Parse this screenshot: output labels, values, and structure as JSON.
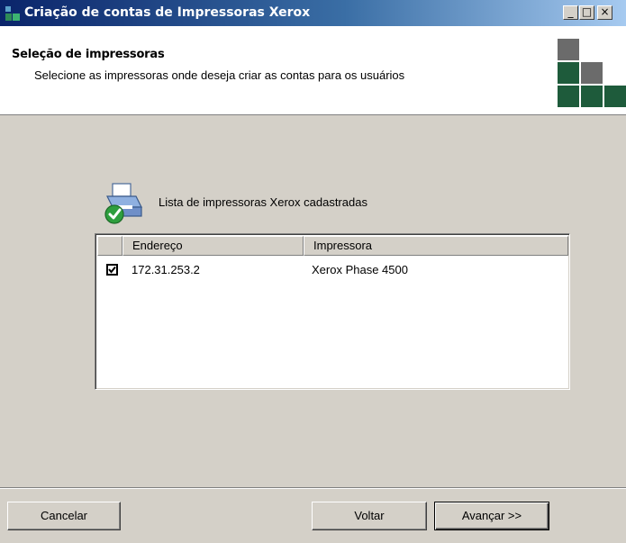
{
  "window": {
    "title": "Criação de contas de Impressoras Xerox",
    "minimize_glyph": "_",
    "maximize_glyph": "□",
    "close_glyph": "×"
  },
  "header": {
    "title": "Seleção de impressoras",
    "subtitle": "Selecione as impressoras onde deseja criar as contas para os usuários",
    "logo_colors": {
      "gray": "#6b6b6b",
      "green": "#1e5b3b"
    }
  },
  "printer_list": {
    "caption": "Lista de impressoras Xerox cadastradas",
    "icon": "printer-check-icon",
    "columns": [
      "Endereço",
      "Impressora"
    ],
    "rows": [
      {
        "checked": true,
        "address": "172.31.253.2",
        "printer": "Xerox Phase 4500"
      }
    ]
  },
  "buttons": {
    "cancel": "Cancelar",
    "back": "Voltar",
    "next": "Avançar >>"
  }
}
